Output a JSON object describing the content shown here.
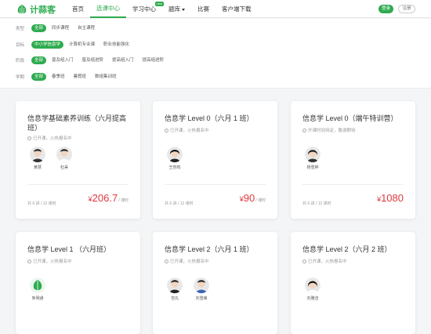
{
  "header": {
    "logo_text": "计蒜客",
    "nav": [
      {
        "label": "首页",
        "active": false
      },
      {
        "label": "选课中心",
        "active": true
      },
      {
        "label": "学习中心",
        "active": false,
        "badge": "new"
      },
      {
        "label": "题库",
        "active": false,
        "dropdown": true
      },
      {
        "label": "比赛",
        "active": false
      },
      {
        "label": "客户端下载",
        "active": false
      }
    ],
    "login": "登录",
    "register": "注册"
  },
  "filters": [
    {
      "label": "类型",
      "options": [
        "全部",
        "同步课程",
        "自主课程"
      ],
      "active": 0
    },
    {
      "label": "目标",
      "options": [
        "中小学信息学",
        "计算机专业课",
        "职业技能强化"
      ],
      "active": 0
    },
    {
      "label": "阶段",
      "options": [
        "全部",
        "普及组入门",
        "普及组进阶",
        "提高组入门",
        "提高组进阶"
      ],
      "active": 0
    },
    {
      "label": "学期",
      "options": [
        "全部",
        "春季班",
        "暑假班",
        "数组集训班"
      ],
      "active": 0
    }
  ],
  "cards": [
    {
      "title": "信息学基础素养训练（六月提高班）",
      "status": "已开课，火热报名中",
      "teachers": [
        "黄慧",
        "杜昊"
      ],
      "lessons": "共 6 讲 / 12 课时",
      "price_symbol": "¥",
      "price": "206.7",
      "price_unit": "/ 课时"
    },
    {
      "title": "信息学 Level 0（六月 1 班）",
      "status": "已开课，火热报名中",
      "teachers": [
        "王恺鸣"
      ],
      "lessons": "共 6 讲 / 12 课时",
      "price_symbol": "¥",
      "price": "90",
      "price_unit": "/ 课时"
    },
    {
      "title": "信息学 Level 0（端午特训营）",
      "status": "开课时间待定，敬请期待",
      "teachers": [
        "杨雪婷"
      ],
      "lessons": "共 6 讲 / 12 课时",
      "price_symbol": "¥",
      "price": "1080",
      "price_unit": ""
    },
    {
      "title": "信息学 Level 1 （六月班）",
      "status": "已开课，火热报名中",
      "teachers": [
        "朱明通"
      ]
    },
    {
      "title": "信息学 Level 2（六月 1 班）",
      "status": "已开课，火热报名中",
      "teachers": [
        "范丸",
        "刘雪峰"
      ]
    },
    {
      "title": "信息学 Level 2（六月 2 班）",
      "status": "已开课，火热报名中",
      "teachers": [
        "刘雅洁"
      ]
    }
  ],
  "colors": {
    "brand": "#2eab4f",
    "price": "#e0383e"
  }
}
